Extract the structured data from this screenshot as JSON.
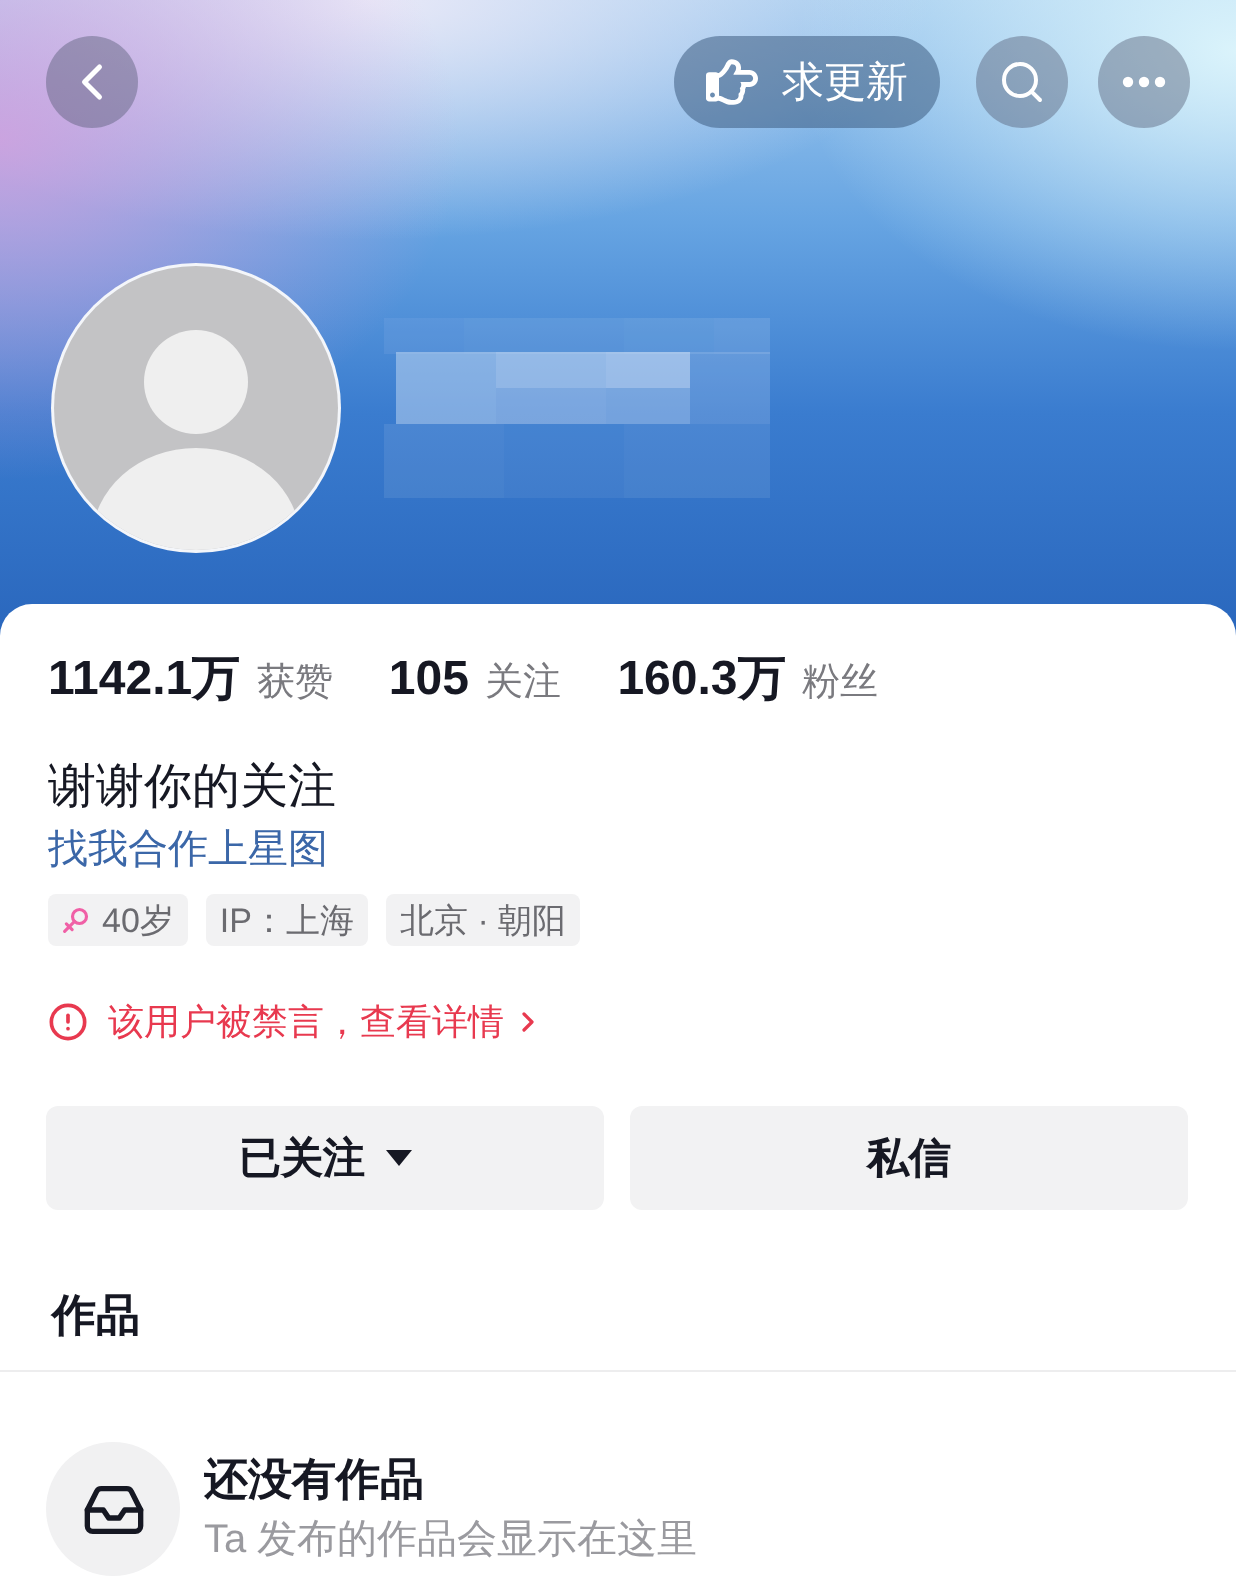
{
  "top_bar": {
    "update_button": {
      "label": "求更新"
    }
  },
  "profile": {
    "stats": [
      {
        "text": "**1142.1万** 获赞"
      },
      {
        "text": "**105** 关注"
      },
      {
        "text": "**160.3万** 粉丝"
      }
    ],
    "bio": "谢谢你的关注",
    "link": "找我合作上星图",
    "tags": [
      {
        "kind": "age",
        "label": "40岁"
      },
      {
        "kind": "text",
        "label": "IP：上海"
      },
      {
        "kind": "text",
        "label": "北京 · 朝阳"
      }
    ],
    "notice": "该用户被禁言，查看详情"
  },
  "actions": [
    {
      "label": "已关注",
      "dropdown": true
    },
    {
      "label": "私信",
      "dropdown": false
    }
  ],
  "section": {
    "title": "作品"
  },
  "empty_state": {
    "title": "还没有作品",
    "subtitle": "Ta 发布的作品会显示在这里"
  }
}
